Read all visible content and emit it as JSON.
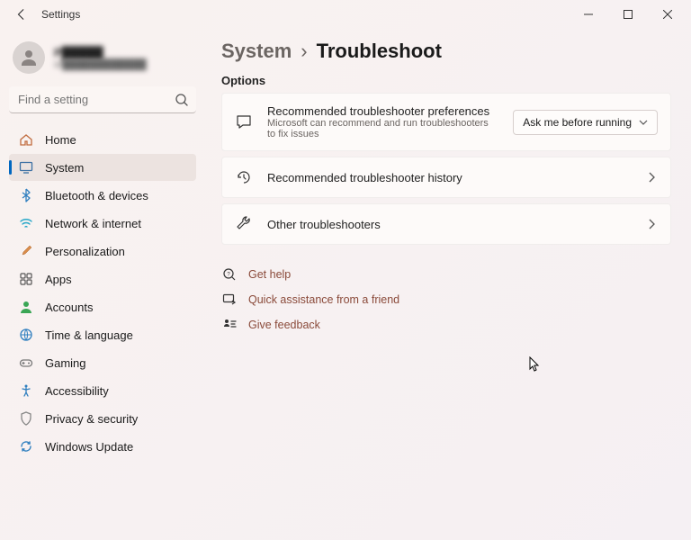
{
  "window": {
    "title": "Settings"
  },
  "profile": {
    "name": "P█████",
    "email": "sr████████████"
  },
  "search": {
    "placeholder": "Find a setting"
  },
  "nav": {
    "items": [
      {
        "id": "home",
        "label": "Home"
      },
      {
        "id": "system",
        "label": "System"
      },
      {
        "id": "bluetooth",
        "label": "Bluetooth & devices"
      },
      {
        "id": "network",
        "label": "Network & internet"
      },
      {
        "id": "personalization",
        "label": "Personalization"
      },
      {
        "id": "apps",
        "label": "Apps"
      },
      {
        "id": "accounts",
        "label": "Accounts"
      },
      {
        "id": "time",
        "label": "Time & language"
      },
      {
        "id": "gaming",
        "label": "Gaming"
      },
      {
        "id": "accessibility",
        "label": "Accessibility"
      },
      {
        "id": "privacy",
        "label": "Privacy & security"
      },
      {
        "id": "update",
        "label": "Windows Update"
      }
    ],
    "active": "system"
  },
  "breadcrumb": {
    "parent": "System",
    "current": "Troubleshoot"
  },
  "sections": {
    "options_label": "Options",
    "pref": {
      "title": "Recommended troubleshooter preferences",
      "sub": "Microsoft can recommend and run troubleshooters to fix issues",
      "dropdown": "Ask me before running"
    },
    "history": {
      "title": "Recommended troubleshooter history"
    },
    "other": {
      "title": "Other troubleshooters"
    }
  },
  "links": {
    "help": "Get help",
    "quick": "Quick assistance from a friend",
    "feedback": "Give feedback"
  }
}
